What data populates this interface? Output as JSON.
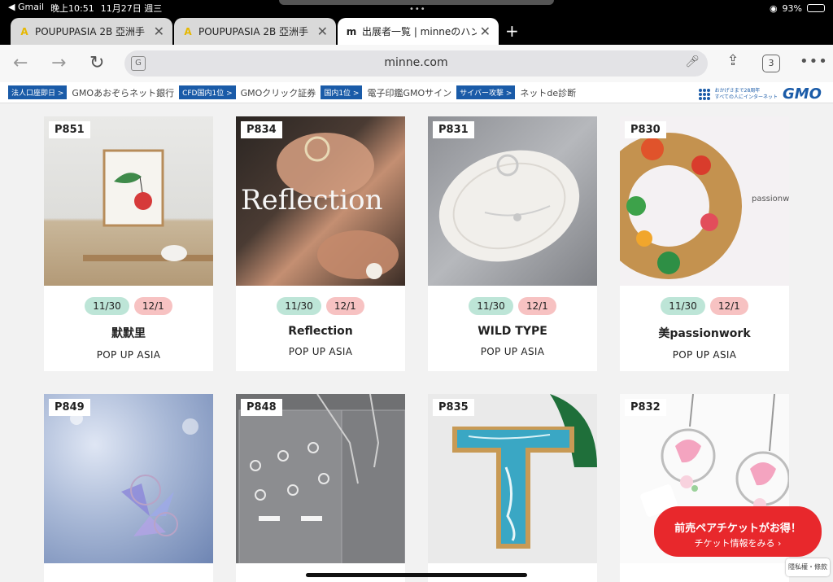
{
  "status": {
    "left_app": "◀ Gmail",
    "time": "晚上10:51",
    "date": "11月27日 週三",
    "battery": "93%",
    "battery_level": 0.93
  },
  "tabs": [
    {
      "label": "POUPUPASIA 2B 亞洲手",
      "favicon": "A"
    },
    {
      "label": "POUPUPASIA 2B 亞洲手",
      "favicon": "A"
    },
    {
      "label": "出展者一覧 | minneのハン",
      "favicon": "m"
    }
  ],
  "address_bar": {
    "url": "minne.com",
    "tabs_count": "3"
  },
  "ad_bar": {
    "items": [
      {
        "badge": "法人口座即日 >",
        "text": "GMOあおぞらネット銀行"
      },
      {
        "badge": "CFD国内1位 >",
        "text": "GMOクリック証券"
      },
      {
        "badge": "国内1位 >",
        "text": "電子印鑑GMOサイン"
      },
      {
        "badge": "サイバー攻撃 >",
        "text": "ネットde診断"
      }
    ],
    "gmo_tagline_1": "おかげさまで28周年",
    "gmo_tagline_2": "すべての人にインターネット",
    "gmo_logo": "GMO"
  },
  "cards": [
    {
      "code": "P851",
      "date1": "11/30",
      "date2": "12/1",
      "name": "默默里",
      "sub": "POP UP ASIA"
    },
    {
      "code": "P834",
      "date1": "11/30",
      "date2": "12/1",
      "name": "Reflection",
      "sub": "POP UP ASIA",
      "photo_text": "Reflection"
    },
    {
      "code": "P831",
      "date1": "11/30",
      "date2": "12/1",
      "name": "WILD TYPE",
      "sub": "POP UP ASIA"
    },
    {
      "code": "P830",
      "date1": "11/30",
      "date2": "12/1",
      "name": "美passionwork",
      "sub": "POP UP ASIA",
      "photo_text": "passionw"
    },
    {
      "code": "P849"
    },
    {
      "code": "P848"
    },
    {
      "code": "P835"
    },
    {
      "code": "P832"
    }
  ],
  "promo": {
    "line1": "前売ペアチケットがお得！",
    "line2": "チケット情報をみる ›"
  },
  "privacy_badge": "隱私權・條款"
}
